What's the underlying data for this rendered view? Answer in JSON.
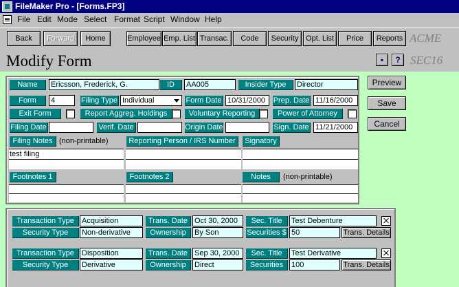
{
  "window": {
    "title": "FileMaker Pro - [Forms.FP3]"
  },
  "menu": [
    "File",
    "Edit",
    "Mode",
    "Select",
    "Format",
    "Script",
    "Window",
    "Help"
  ],
  "nav": {
    "back": "Back",
    "forward": "Forward",
    "home": "Home",
    "employee": "Employee",
    "emp_list": "Emp. List",
    "transac": "Transac.",
    "code": "Code",
    "security": "Security",
    "opt_list": "Opt. List",
    "price": "Price",
    "reports": "Reports",
    "brand": "ACME"
  },
  "header": {
    "title": "Modify Form",
    "code": "SEC16",
    "help": "?"
  },
  "form": {
    "name_label": "Name",
    "name": "Ericsson, Frederick, G.",
    "id_label": "ID",
    "id": "AA005",
    "insider_type_label": "Insider Type",
    "insider_type": "Director",
    "form_label": "Form",
    "form": "4",
    "filing_type_label": "Filing Type",
    "filing_type": "Individual",
    "form_date_label": "Form Date",
    "form_date": "10/31/2000",
    "prep_date_label": "Prep. Date",
    "prep_date": "11/16/2000",
    "exit_form_label": "Exit Form",
    "report_aggreg_label": "Report Aggreg. Holdings",
    "voluntary_label": "Voluntary Reporting",
    "poa_label": "Power of Attorney",
    "filing_date_label": "Filing Date",
    "filing_date": "",
    "verif_date_label": "Verif. Date",
    "verif_date": "",
    "origin_date_label": "Origin Date",
    "origin_date": "",
    "sign_date_label": "Sign. Date",
    "sign_date": "11/21/2000",
    "filing_notes_label": "Filing Notes",
    "filing_notes_note": "(non-printable)",
    "filing_notes": "test filing",
    "reporting_person_label": "Reporting  Person / IRS Number",
    "reporting_person": "",
    "signatory_label": "Signatory",
    "signatory": "",
    "footnotes1_label": "Footnotes 1",
    "footnotes2_label": "Footnotes 2",
    "notes_label": "Notes",
    "notes_note": "(non-printable)"
  },
  "actions": {
    "preview": "Preview",
    "save": "Save",
    "cancel": "Cancel"
  },
  "transactions": [
    {
      "transaction_type_label": "Transaction Type",
      "transaction_type": "Acquisition",
      "trans_date_label": "Trans. Date",
      "trans_date": "Oct 30, 2000",
      "sec_title_label": "Sec. Title",
      "sec_title": "Test Debenture",
      "security_type_label": "Security Type",
      "security_type": "Non-derivative",
      "ownership_label": "Ownership",
      "ownership": "By Son",
      "securities_label": "Securities $",
      "securities": "50",
      "details_button": "Trans. Details"
    },
    {
      "transaction_type_label": "Transaction Type",
      "transaction_type": "Disposition",
      "trans_date_label": "Trans. Date",
      "trans_date": "Sep 30, 2000",
      "sec_title_label": "Sec. Title",
      "sec_title": "Test Derivative",
      "security_type_label": "Security Type",
      "security_type": "Derivative",
      "ownership_label": "Ownership",
      "ownership": "Direct",
      "securities_label": "Securities",
      "securities": "100",
      "details_button": "Trans. Details"
    }
  ],
  "colors": {
    "label_bg": "#008080",
    "field_cyan": "#e0ffff",
    "canvas_bg": "#c0ffc0",
    "titlebar": "#000080"
  }
}
